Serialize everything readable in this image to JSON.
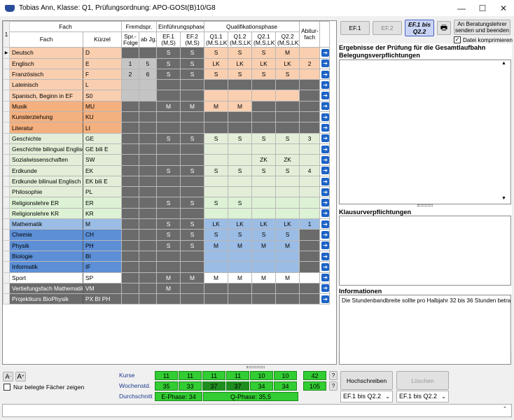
{
  "window": {
    "title": "Tobias Ann, Klasse: Q1, Prüfungsordnung: APO-GOSt(B)10/G8",
    "minimize": "—",
    "maximize": "☐",
    "close": "✕"
  },
  "colors": {
    "spr": "#f9cfb0",
    "spr_dark": "#f4b07e",
    "ges": "#e3eed8",
    "mint": "#ddf1d4",
    "nat": "#9bbce4",
    "nat_sel": "#5c8fd6",
    "sport": "#ffffff",
    "grey": "#6b6b6b",
    "green": "#32cd32"
  },
  "header": {
    "corner": "1",
    "fach_group": "Fach",
    "fach": "Fach",
    "kuerzel": "Kürzel",
    "fremdspr": "Fremdspr.",
    "sprfolge": "Spr.-Folge",
    "abjg": "ab Jg.",
    "ef_phase": "Einführungsphase",
    "ef1": "EF.1",
    "ef1s": "(M,S)",
    "ef2": "EF.2",
    "ef2s": "(M,S)",
    "q_phase": "Qualifikationsphase",
    "q11": "Q1.1",
    "q12": "Q1.2",
    "q21": "Q2.1",
    "q22": "Q2.2",
    "qs": "(M,S,LK)",
    "abitur": "Abitur-",
    "abitur2": "fach"
  },
  "rows": [
    {
      "fach": "Deutsch",
      "kz": "D",
      "bg": "spr",
      "sf": "",
      "jg": "",
      "ef1": "S",
      "ef2": "S",
      "q11": "S",
      "q12": "S",
      "q21": "S",
      "q22": "M",
      "abi": "",
      "sel": true
    },
    {
      "fach": "Englisch",
      "kz": "E",
      "bg": "spr",
      "sf": "1",
      "jg": "5",
      "ef1": "S",
      "ef2": "S",
      "q11": "LK",
      "q12": "LK",
      "q21": "LK",
      "q22": "LK",
      "abi": "2"
    },
    {
      "fach": "Französisch",
      "kz": "F",
      "bg": "spr",
      "sf": "2",
      "jg": "6",
      "ef1": "S",
      "ef2": "S",
      "q11": "S",
      "q12": "S",
      "q21": "S",
      "q22": "S",
      "abi": ""
    },
    {
      "fach": "Lateinisch",
      "kz": "L",
      "bg": "spr",
      "sf": "",
      "jg": "",
      "ef1": "",
      "ef2": "",
      "q11": "",
      "q12": "",
      "q21": "",
      "q22": "",
      "abi": "",
      "qdark": true
    },
    {
      "fach": "Spanisch, Beginn in EF",
      "kz": "S0",
      "bg": "spr",
      "sf": "",
      "jg": "",
      "ef1": "",
      "ef2": "",
      "q11": "",
      "q12": "",
      "q21": "",
      "q22": "",
      "abi": ""
    },
    {
      "fach": "Musik",
      "kz": "MU",
      "bg": "spr_dark",
      "sf": "",
      "jg": "",
      "ef1": "M",
      "ef2": "M",
      "q11": "M",
      "q12": "M",
      "q21": "",
      "q22": "",
      "abi": ""
    },
    {
      "fach": "Kunsterziehung",
      "kz": "KU",
      "bg": "spr_dark",
      "sf": "",
      "jg": "",
      "ef1": "",
      "ef2": "",
      "q11": "",
      "q12": "",
      "q21": "",
      "q22": "",
      "abi": ""
    },
    {
      "fach": "Literatur",
      "kz": "LI",
      "bg": "spr_dark",
      "sf": "",
      "jg": "",
      "ef1": "",
      "ef2": "",
      "q11": "",
      "q12": "",
      "q21": "",
      "q22": "",
      "abi": "",
      "qdark": true
    },
    {
      "fach": "Geschichte",
      "kz": "GE",
      "bg": "ges",
      "sf": "",
      "jg": "",
      "ef1": "S",
      "ef2": "S",
      "q11": "S",
      "q12": "S",
      "q21": "S",
      "q22": "S",
      "abi": "3"
    },
    {
      "fach": "Geschichte bilingual Englisch",
      "kz": "GE bili E",
      "bg": "ges",
      "sf": "",
      "jg": "",
      "ef1": "",
      "ef2": "",
      "q11": "",
      "q12": "",
      "q21": "",
      "q22": "",
      "abi": ""
    },
    {
      "fach": "Sozialwissenschaften",
      "kz": "SW",
      "bg": "ges",
      "sf": "",
      "jg": "",
      "ef1": "",
      "ef2": "",
      "q11": "",
      "q12": "",
      "q21": "ZK",
      "q22": "ZK",
      "abi": ""
    },
    {
      "fach": "Erdkunde",
      "kz": "EK",
      "bg": "ges",
      "sf": "",
      "jg": "",
      "ef1": "S",
      "ef2": "S",
      "q11": "S",
      "q12": "S",
      "q21": "S",
      "q22": "S",
      "abi": "4"
    },
    {
      "fach": "Erdkunde bilinual Englisch",
      "kz": "EK bili E",
      "bg": "ges",
      "sf": "",
      "jg": "",
      "ef1": "",
      "ef2": "",
      "q11": "",
      "q12": "",
      "q21": "",
      "q22": "",
      "abi": ""
    },
    {
      "fach": "Philosophie",
      "kz": "PL",
      "bg": "ges",
      "sf": "",
      "jg": "",
      "ef1": "",
      "ef2": "",
      "q11": "",
      "q12": "",
      "q21": "",
      "q22": "",
      "abi": ""
    },
    {
      "fach": "Religionslehre ER",
      "kz": "ER",
      "bg": "mint",
      "sf": "",
      "jg": "",
      "ef1": "S",
      "ef2": "S",
      "q11": "S",
      "q12": "S",
      "q21": "",
      "q22": "",
      "abi": ""
    },
    {
      "fach": "Religionslehre KR",
      "kz": "KR",
      "bg": "mint",
      "sf": "",
      "jg": "",
      "ef1": "",
      "ef2": "",
      "q11": "",
      "q12": "",
      "q21": "",
      "q22": "",
      "abi": ""
    },
    {
      "fach": "Mathematik",
      "kz": "M",
      "bg": "nat",
      "sf": "",
      "jg": "",
      "ef1": "S",
      "ef2": "S",
      "q11": "LK",
      "q12": "LK",
      "q21": "LK",
      "q22": "LK",
      "abi": "1"
    },
    {
      "fach": "Chemie",
      "kz": "CH",
      "bg": "nat_sel",
      "sf": "",
      "jg": "",
      "ef1": "S",
      "ef2": "S",
      "q11": "S",
      "q12": "S",
      "q21": "S",
      "q22": "S",
      "abi": ""
    },
    {
      "fach": "Physik",
      "kz": "PH",
      "bg": "nat_sel",
      "sf": "",
      "jg": "",
      "ef1": "S",
      "ef2": "S",
      "q11": "M",
      "q12": "M",
      "q21": "M",
      "q22": "M",
      "abi": ""
    },
    {
      "fach": "Biologie",
      "kz": "BI",
      "bg": "nat_sel",
      "sf": "",
      "jg": "",
      "ef1": "",
      "ef2": "",
      "q11": "",
      "q12": "",
      "q21": "",
      "q22": "",
      "abi": ""
    },
    {
      "fach": "Informatik",
      "kz": "IF",
      "bg": "nat_sel",
      "sf": "",
      "jg": "",
      "ef1": "",
      "ef2": "",
      "q11": "",
      "q12": "",
      "q21": "",
      "q22": "",
      "abi": ""
    },
    {
      "fach": "Sport",
      "kz": "SP",
      "bg": "sport",
      "sf": "",
      "jg": "",
      "ef1": "M",
      "ef2": "M",
      "q11": "M",
      "q12": "M",
      "q21": "M",
      "q22": "M",
      "abi": ""
    },
    {
      "fach": "Vertiefungsfach Mathematik",
      "kz": "VM",
      "bg": "grey",
      "sf": "",
      "jg": "",
      "ef1": "M",
      "ef2": "",
      "q11": "",
      "q12": "",
      "q21": "",
      "q22": "",
      "abi": "",
      "qdark": true
    },
    {
      "fach": "Projektkurs BioPhysik",
      "kz": "PX BI PH",
      "bg": "grey",
      "sf": "",
      "jg": "",
      "ef1": "",
      "ef2": "",
      "q11": "",
      "q12": "",
      "q21": "",
      "q22": "",
      "abi": "",
      "qdark": true
    }
  ],
  "right": {
    "btn_ef1": "EF.1",
    "btn_ef2": "EF.2",
    "btn_efq": "EF.1 bis Q2.2",
    "btn_send": "An Beratungslehrer senden und beenden",
    "compress_label": "Datei komprimieren",
    "result_title": "Ergebnisse der Prüfung für die Gesamtlaufbahn",
    "beleg_title": "Belegungsverpflichtungen",
    "klausur_title": "Klausurverpflichtungen",
    "info_title": "Informationen",
    "info_text": "Die Stundenbandbreite sollte pro Halbjahr 32 bis 36 Stunden betra"
  },
  "bottom": {
    "font_bigger": "A",
    "font_smaller": "A",
    "only_label": "Nur belegte Fächer zeigen",
    "kurse_label": "Kurse",
    "wstd_label": "Wochenstd.",
    "dschn_label": "Durchschnitt",
    "kurse": [
      "11",
      "11",
      "11",
      "11",
      "10",
      "10"
    ],
    "kurse_total": "42",
    "wstd": [
      "35",
      "33",
      "37",
      "37",
      "34",
      "34"
    ],
    "wstd_total": "105",
    "e_phase": "E-Phase: 34",
    "q_phase": "Q-Phase: 35,5",
    "q1": "?",
    "q2": "?",
    "btn_hoch": "Hochschreiben",
    "btn_loeschen": "Löschen",
    "sel1": "EF.1 bis Q2.2",
    "sel2": "EF.1 bis Q2.2"
  }
}
